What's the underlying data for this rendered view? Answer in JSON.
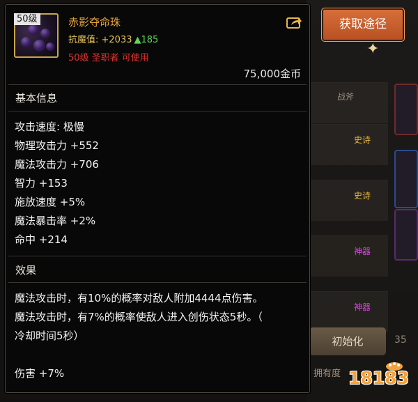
{
  "item": {
    "level_badge": "50级",
    "name": "赤影夺命珠",
    "resistance_label": "抗魔值: +2033",
    "resistance_delta": "▲185",
    "requirement": "50级 圣职者 可使用",
    "price": "75,000金币"
  },
  "basic_info": {
    "title": "基本信息",
    "stats": [
      "攻击速度: 极慢",
      "物理攻击力 +552",
      "魔法攻击力 +706",
      "智力 +153",
      "施放速度 +5%",
      "魔法暴击率 +2%",
      "命中 +214"
    ]
  },
  "effect": {
    "title": "效果",
    "lines": [
      "魔法攻击时，有10%的概率对敌人附加4444点伤害。",
      "魔法攻击时，有7%的概率使敌人进入创伤状态5秒。（",
      "冷却时间5秒）",
      "",
      "伤害 +7%"
    ]
  },
  "buttons": {
    "get_route": "获取途径",
    "reset": "初始化"
  },
  "background": {
    "tab_label": "战斧",
    "tags": [
      "史诗",
      "史诗",
      "神器",
      "神器"
    ],
    "number": "35",
    "bottom_text": "拥有度"
  },
  "watermark": "18183",
  "colors": {
    "item_name": "#e8a43a",
    "requirement": "#e0332e",
    "resist_up": "#5fd65a",
    "epic": "#e8b93a",
    "artifact": "#d04ad8"
  }
}
